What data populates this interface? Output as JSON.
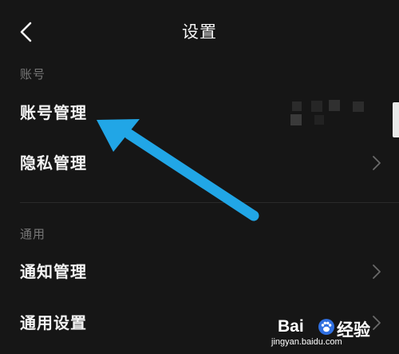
{
  "header": {
    "title": "设置",
    "back_icon": "chevron-left-icon"
  },
  "sections": [
    {
      "label": "账号",
      "items": [
        {
          "label": "账号管理"
        },
        {
          "label": "隐私管理",
          "icon": "chevron-right-icon"
        }
      ]
    },
    {
      "label": "通用",
      "items": [
        {
          "label": "通知管理",
          "icon": "chevron-right-icon"
        },
        {
          "label": "通用设置",
          "icon": "chevron-right-icon"
        }
      ]
    }
  ],
  "annotation": {
    "arrow_color": "#21a6e6"
  },
  "watermark": {
    "brand": "Bai",
    "brand_suffix": "经验",
    "url": "jingyan.baidu.com"
  },
  "colors": {
    "background": "#161616",
    "text": "#f2f2f2",
    "section_label": "#777777"
  }
}
